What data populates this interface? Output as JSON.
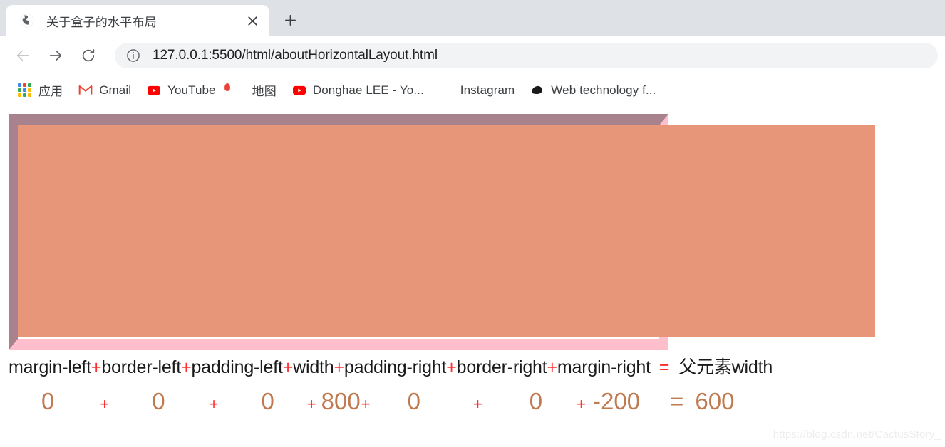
{
  "browser": {
    "tab": {
      "title": "关于盒子的水平布局",
      "favicon_icon": "globe-icon",
      "close_icon": "close-icon"
    },
    "new_tab_icon": "plus-icon",
    "toolbar": {
      "back_icon": "arrow-left-icon",
      "forward_icon": "arrow-right-icon",
      "reload_icon": "reload-icon",
      "site_info_icon": "info-circle-icon",
      "url": "127.0.0.1:5500/html/aboutHorizontalLayout.html"
    },
    "bookmarks": [
      {
        "label": "应用",
        "icon": "apps-grid-icon"
      },
      {
        "label": "Gmail",
        "icon": "gmail-icon"
      },
      {
        "label": "YouTube",
        "icon": "youtube-icon"
      },
      {
        "label": "地图",
        "icon": "google-maps-icon"
      },
      {
        "label": "Donghae LEE - Yo...",
        "icon": "youtube-icon"
      },
      {
        "label": "Instagram",
        "icon": "instagram-icon"
      },
      {
        "label": "Web technology f...",
        "icon": "mdn-icon"
      }
    ]
  },
  "page": {
    "parent_box": {
      "border_top_color": "#a8828c",
      "border_left_color": "#a8828c",
      "border_right_color": "#ffbecb",
      "border_bottom_color": "#ffbecb"
    },
    "child_box": {
      "background_color": "#e8967a"
    },
    "formula": {
      "terms": [
        "margin-left",
        "border-left",
        "padding-left",
        "width",
        "padding-right",
        "border-right",
        "margin-right"
      ],
      "operator": "+",
      "equals": "=",
      "result": "父元素width"
    },
    "values": {
      "numbers": [
        "0",
        "0",
        "0",
        "800",
        "0",
        "0",
        "-200"
      ],
      "operator": "+",
      "equals": "=",
      "result": "600"
    },
    "watermark": "https://blog.csdn.net/CactusStory_"
  }
}
